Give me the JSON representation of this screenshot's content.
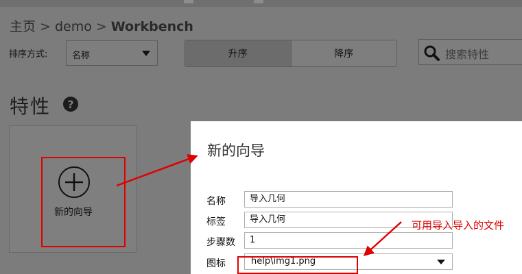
{
  "breadcrumb": {
    "items": [
      "主页",
      "demo",
      "Workbench"
    ],
    "separator": ">"
  },
  "toolbar": {
    "sort_label": "排序方式:",
    "sort_value": "名称",
    "order_asc": "升序",
    "order_desc": "降序",
    "search_placeholder": "搜索特性"
  },
  "section": {
    "title": "特性",
    "help_glyph": "?"
  },
  "card": {
    "icon": "plus-circle-icon",
    "label": "新的向导"
  },
  "dialog": {
    "title": "新的向导",
    "fields": [
      {
        "label": "名称",
        "value": "导入几何"
      },
      {
        "label": "标签",
        "value": "导入几何"
      },
      {
        "label": "步骤数",
        "value": "1"
      },
      {
        "label": "图标",
        "value": "help\\img1.png"
      }
    ]
  },
  "annotation": {
    "text": "可用导入导入的文件",
    "color": "#e00000"
  },
  "colors": {
    "overlay": "#7c7c7c",
    "dialog_bg": "#ffffff",
    "highlight_red": "#e00000"
  }
}
